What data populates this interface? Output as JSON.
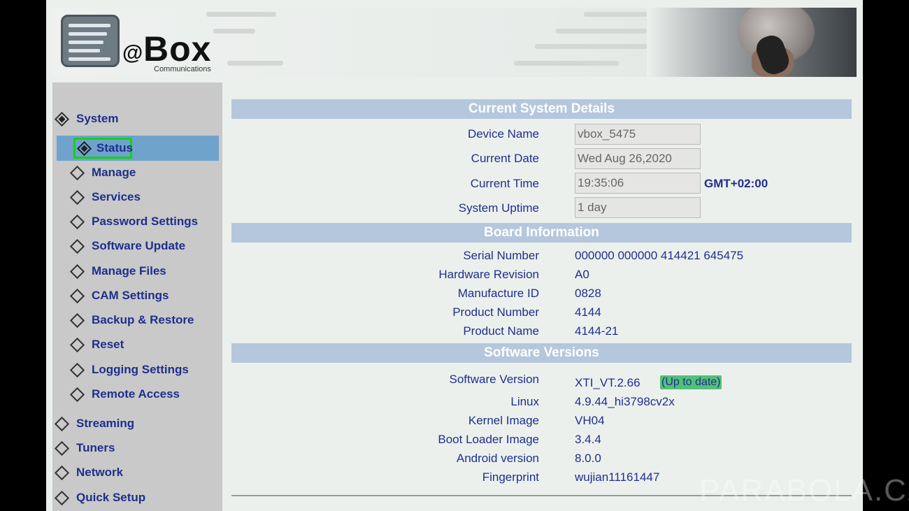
{
  "header": {
    "logo_at": "@",
    "logo_name": "Box",
    "logo_sub": "Communications"
  },
  "sidebar": {
    "system": "System",
    "status": "Status",
    "sub_items": [
      "Manage",
      "Services",
      "Password Settings",
      "Software Update",
      "Manage Files",
      "CAM Settings",
      "Backup & Restore",
      "Reset",
      "Logging Settings",
      "Remote Access"
    ],
    "top_items": [
      "Streaming",
      "Tuners",
      "Network",
      "Quick Setup"
    ]
  },
  "current": {
    "title": "Current System Details",
    "device_name_label": "Device Name",
    "device_name": "vbox_5475",
    "current_date_label": "Current Date",
    "current_date": "Wed Aug 26,2020",
    "current_time_label": "Current Time",
    "current_time": "19:35:06",
    "timezone": "GMT+02:00",
    "uptime_label": "System Uptime",
    "uptime": "1 day"
  },
  "board": {
    "title": "Board Information",
    "rows": [
      {
        "label": "Serial Number",
        "value": "000000 000000 414421 645475"
      },
      {
        "label": "Hardware Revision",
        "value": "A0"
      },
      {
        "label": "Manufacture ID",
        "value": "0828"
      },
      {
        "label": "Product Number",
        "value": "4144"
      },
      {
        "label": "Product Name",
        "value": "4144-21"
      }
    ]
  },
  "software": {
    "title": "Software Versions",
    "version_label": "Software Version",
    "version": "XTI_VT.2.66",
    "status": "(Up to date)",
    "rows": [
      {
        "label": "Linux",
        "value": "4.9.44_hi3798cv2x"
      },
      {
        "label": "Kernel Image",
        "value": "VH04"
      },
      {
        "label": "Boot Loader Image",
        "value": "3.4.4"
      },
      {
        "label": "Android version",
        "value": "8.0.0"
      },
      {
        "label": "Fingerprint",
        "value": "wujian11161447"
      }
    ]
  },
  "watermark": "PARABOLA.CZ",
  "colors": {
    "accent": "#1e2f8c",
    "section": "#b4c7dc",
    "selected": "#6fa3cc",
    "highlight": "#15d215",
    "uptodate": "#52c078"
  }
}
